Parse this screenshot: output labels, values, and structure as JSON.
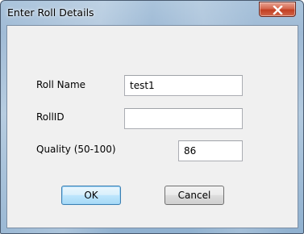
{
  "window": {
    "title": "Enter Roll Details"
  },
  "form": {
    "roll_name_label": "Roll Name",
    "roll_name_value": "test1",
    "roll_id_label": "RollID",
    "roll_id_value": "",
    "quality_label": "Quality (50-100)",
    "quality_value": "86"
  },
  "buttons": {
    "ok_label": "OK",
    "cancel_label": "Cancel"
  },
  "icons": {
    "close": "close-icon"
  },
  "colors": {
    "close_button": "#c94a2f",
    "default_button_border": "#3c7fb1"
  }
}
